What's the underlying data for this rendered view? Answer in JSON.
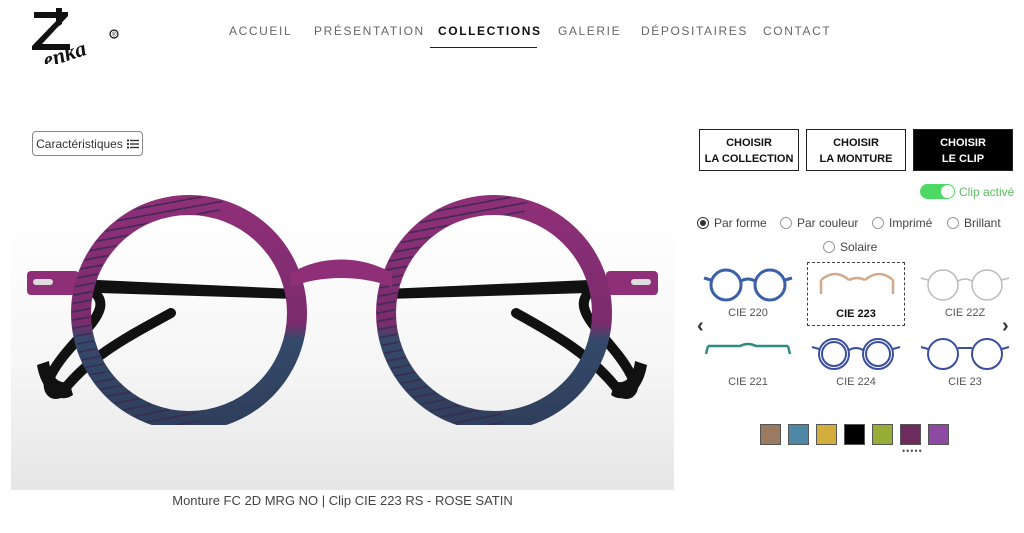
{
  "brand": {
    "logo_text": "Zenka",
    "registered": "®"
  },
  "nav": {
    "items": [
      {
        "label": "ACCUEIL"
      },
      {
        "label": "PRÉSENTATION"
      },
      {
        "label": "COLLECTIONS",
        "active": true
      },
      {
        "label": "GALERIE"
      },
      {
        "label": "DÉPOSITAIRES"
      },
      {
        "label": "CONTACT"
      }
    ]
  },
  "characteristics_button": {
    "label": "Caractéristiques",
    "icon": "list-icon"
  },
  "caption": "Monture FC 2D MRG NO | Clip CIE 223 RS - ROSE SATIN",
  "choices": [
    {
      "line1": "CHOISIR",
      "line2": "LA COLLECTION"
    },
    {
      "line1": "CHOISIR",
      "line2": "LA MONTURE"
    },
    {
      "line1": "CHOISIR",
      "line2": "LE CLIP",
      "active": true
    }
  ],
  "clip_toggle": {
    "label": "Clip activé",
    "on": true,
    "color": "#4cd964"
  },
  "filters": [
    {
      "label": "Par forme",
      "checked": true
    },
    {
      "label": "Par couleur",
      "checked": false
    },
    {
      "label": "Imprimé",
      "checked": false
    },
    {
      "label": "Brillant",
      "checked": false
    },
    {
      "label": "Solaire",
      "checked": false
    }
  ],
  "clips": [
    {
      "label": "CIE 220",
      "color": "#3b5fa8",
      "selected": false
    },
    {
      "label": "CIE 223",
      "color": "#d2a98a",
      "selected": true
    },
    {
      "label": "CIE 22Z",
      "color": "#bbbbbb",
      "selected": false
    },
    {
      "label": "CIE 221",
      "color": "#2f8a86",
      "selected": false
    },
    {
      "label": "CIE 224",
      "color": "#3a4fa0",
      "selected": false
    },
    {
      "label": "CIE 23",
      "color": "#3a4fa0",
      "selected": false
    }
  ],
  "nav_arrows": {
    "prev": "‹",
    "next": "›"
  },
  "swatches": {
    "colors": [
      "#9a7a60",
      "#4f88a6",
      "#d3ae3c",
      "#000000",
      "#97ad35",
      "#6e2b5e",
      "#8e49a3"
    ],
    "selected_index": 5,
    "dots": "•••••"
  },
  "frame_colors": {
    "rim_top": "#8e2f78",
    "rim_bottom": "#35496a",
    "temple": "#111111"
  }
}
